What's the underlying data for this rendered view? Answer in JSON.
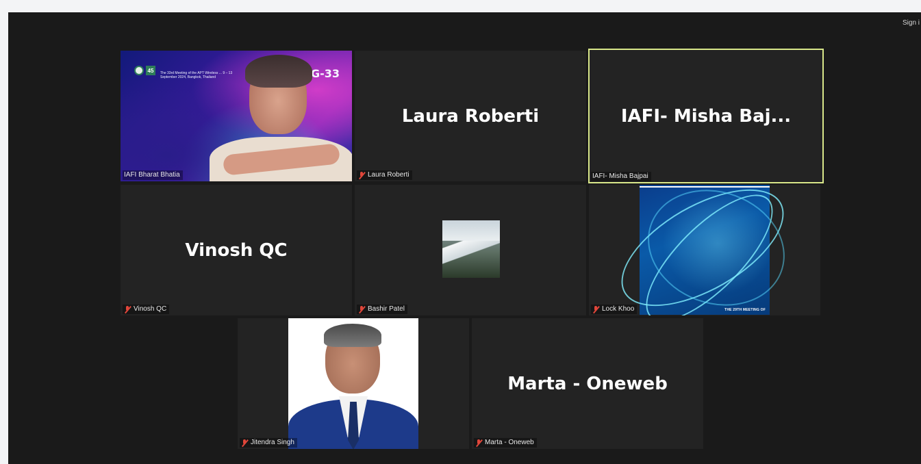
{
  "header": {
    "sign_in_label": "Sign i"
  },
  "tiles": {
    "bharat": {
      "label": "IAFI Bharat Bhatia",
      "banner_badge": "45",
      "banner_text": "The 33rd Meeting of the APT Wireless ... 9 – 13 September 2024, Bangkok, Thailand",
      "banner_code": "WG-33"
    },
    "laura": {
      "display_name": "Laura Roberti",
      "label": "Laura Roberti",
      "muted": true
    },
    "misha": {
      "display_name": "IAFI- Misha Baj...",
      "label": "IAFI- Misha Bajpai",
      "muted": false,
      "active_speaker": true
    },
    "vinosh": {
      "display_name": "Vinosh QC",
      "label": "Vinosh QC",
      "muted": true
    },
    "bashir": {
      "label": "Bashir Patel",
      "muted": true
    },
    "lock": {
      "label": "Lock Khoo",
      "muted": true,
      "slide_caption": "THE 29TH MEETING OF"
    },
    "jitendra": {
      "label": "Jitendra Singh",
      "muted": true
    },
    "marta": {
      "display_name": "Marta - Oneweb",
      "label": "Marta - Oneweb",
      "muted": true
    }
  },
  "colors": {
    "stage_bg": "#1a1a1a",
    "tile_bg": "#232323",
    "active_speaker_border": "#d9e88a",
    "muted_icon": "#e0463a"
  }
}
